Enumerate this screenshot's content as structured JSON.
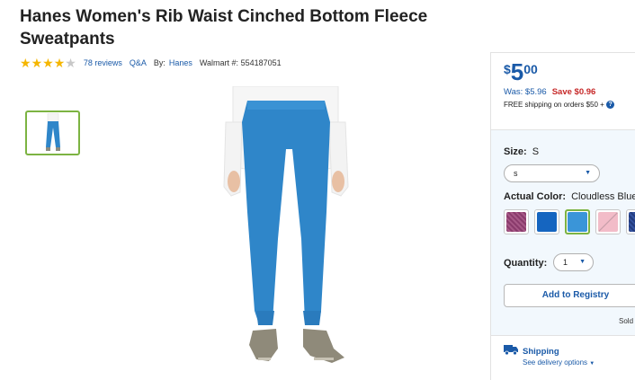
{
  "product": {
    "title": "Hanes Women's Rib Waist Cinched Bottom Fleece Sweatpants",
    "rating": 4,
    "rating_max": 5,
    "reviews_label": "78 reviews",
    "qa_label": "Q&A",
    "by_label": "By:",
    "brand": "Hanes",
    "walmart_id_label": "Walmart #: 554187051",
    "colors": {
      "title": "#222222",
      "link": "#1a5aa8",
      "star": "#f5b600",
      "accent_green": "#7cb342",
      "pants_blue": "#2f86c9"
    }
  },
  "gallery": {
    "thumb_icon": "pants-thumbnail-icon",
    "main_image_icon": "pants-model-image-icon"
  },
  "pricing": {
    "currency": "$",
    "whole": "5",
    "cents": "00",
    "was_label": "Was: $5.96",
    "save_label": "Save $0.96",
    "free_shipping_label": "FREE shipping on orders $50 +",
    "info_icon": "info-icon",
    "info_glyph": "?"
  },
  "options": {
    "size_label": "Size:",
    "size_value": "S",
    "size_select_value": "s",
    "color_label": "Actual Color:",
    "color_value": "Cloudless Blue",
    "swatches": [
      {
        "name": "purple-heather",
        "color": "#8a3b6c"
      },
      {
        "name": "deep-blue",
        "color": "#1565c0"
      },
      {
        "name": "cloudless-blue",
        "color": "#3a95d8",
        "selected": true
      },
      {
        "name": "pink",
        "color": "#f2bcc8"
      },
      {
        "name": "navy",
        "color": "#233b7d"
      }
    ],
    "quantity_label": "Quantity:",
    "quantity_value": "1",
    "registry_button": "Add to Registry",
    "sold_by_label": "Sold b"
  },
  "shipping": {
    "title": "Shipping",
    "options_link": "See delivery options",
    "truck_icon": "truck-icon"
  }
}
